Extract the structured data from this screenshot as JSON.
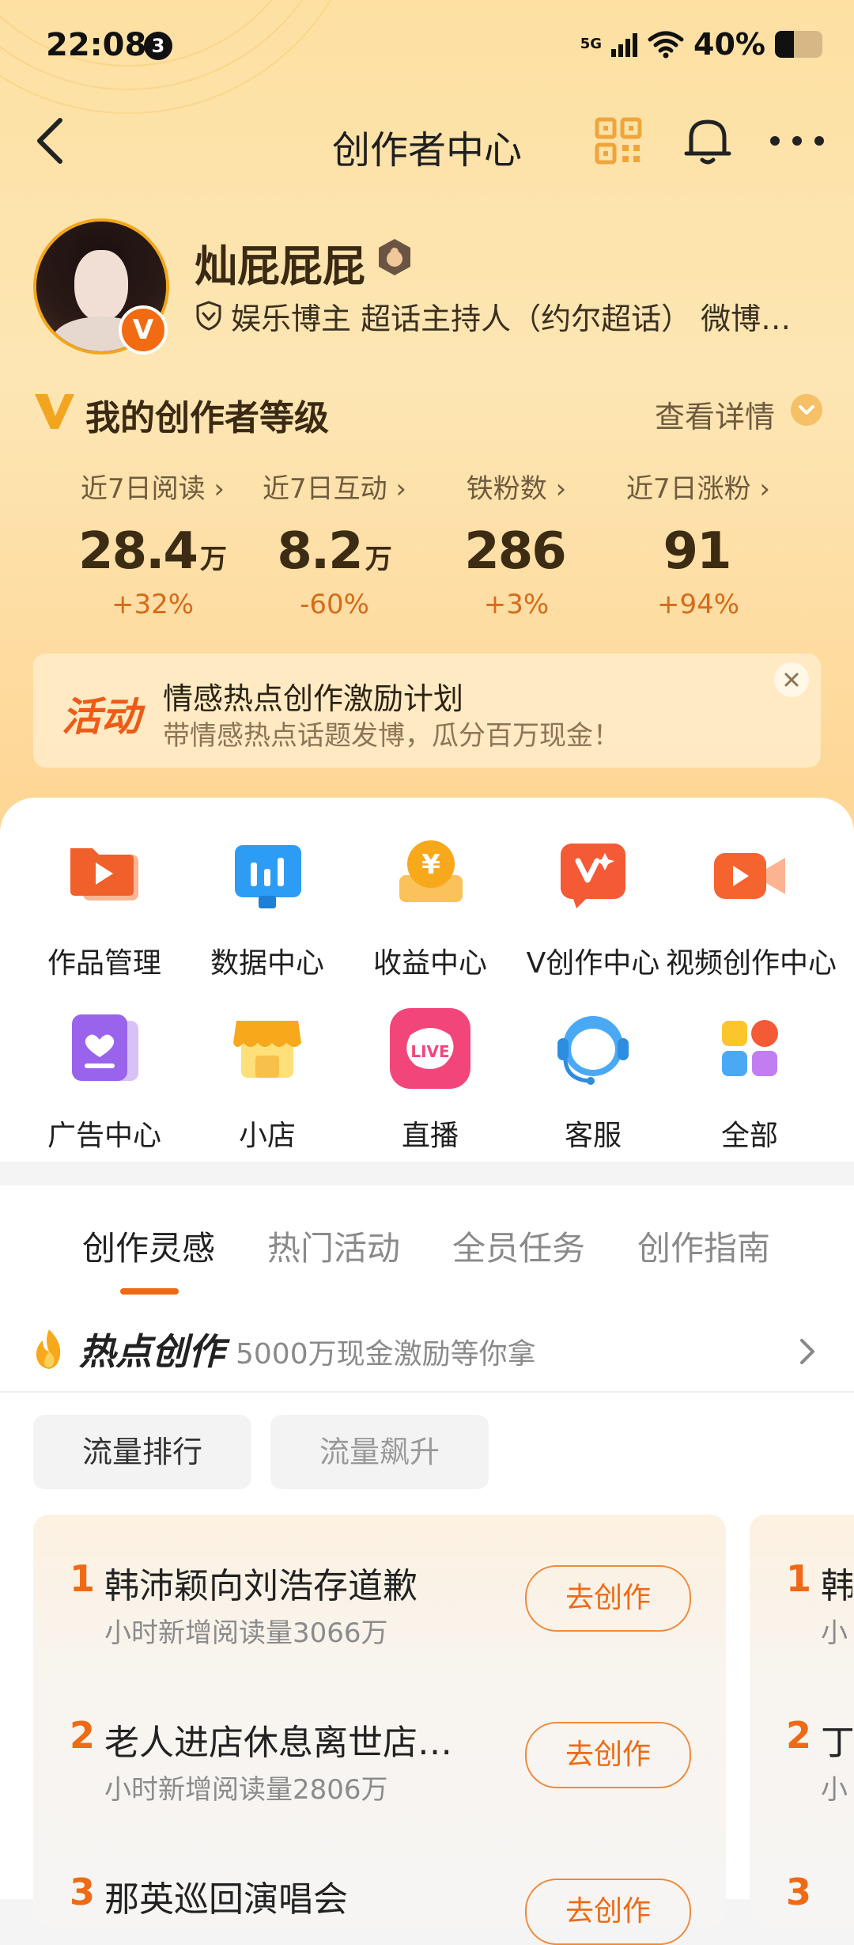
{
  "status_bar": {
    "time": "22:08",
    "notification_count": "3",
    "network": "5G",
    "battery": "40%",
    "battery_level": 0.4
  },
  "nav": {
    "title": "创作者中心",
    "icons": [
      "back-icon",
      "qr-code-icon",
      "bell-icon",
      "more-icon"
    ]
  },
  "profile": {
    "username": "灿屁屁屁",
    "tags": "娱乐博主 超话主持人（约尔超话） 微博…",
    "verified_badge": "V"
  },
  "level": {
    "title": "我的创作者等级",
    "detail_link": "查看详情"
  },
  "stats": [
    {
      "label": "近7日阅读 ›",
      "value": "28.4",
      "unit": "万",
      "change": "+32%"
    },
    {
      "label": "近7日互动 ›",
      "value": "8.2",
      "unit": "万",
      "change": "-60%"
    },
    {
      "label": "铁粉数 ›",
      "value": "286",
      "unit": "",
      "change": "+3%"
    },
    {
      "label": "近7日涨粉 ›",
      "value": "91",
      "unit": "",
      "change": "+94%"
    }
  ],
  "activity": {
    "tag": "活动",
    "title": "情感热点创作激励计划",
    "subtitle": "带情感热点话题发博，瓜分百万现金！"
  },
  "tools": [
    {
      "label": "作品管理",
      "icon": "works-folder-icon"
    },
    {
      "label": "数据中心",
      "icon": "data-chart-icon"
    },
    {
      "label": "收益中心",
      "icon": "income-yuan-icon"
    },
    {
      "label": "V创作中心",
      "icon": "v-create-icon"
    },
    {
      "label": "视频创作中心",
      "icon": "video-camera-icon"
    },
    {
      "label": "广告中心",
      "icon": "ad-heart-icon"
    },
    {
      "label": "小店",
      "icon": "shop-icon"
    },
    {
      "label": "直播",
      "icon": "live-icon"
    },
    {
      "label": "客服",
      "icon": "customer-service-icon"
    },
    {
      "label": "全部",
      "icon": "all-apps-icon"
    }
  ],
  "tabs": [
    "创作灵感",
    "热门活动",
    "全员任务",
    "创作指南"
  ],
  "active_tab": 0,
  "hot": {
    "title": "热点创作",
    "subtitle": "5000万现金激励等你拿"
  },
  "pills": [
    "流量排行",
    "流量飙升"
  ],
  "ranking": [
    {
      "no": "1",
      "title": "韩沛颖向刘浩存道歉",
      "sub": "小时新增阅读量3066万",
      "button": "去创作"
    },
    {
      "no": "2",
      "title": "老人进店休息离世店…",
      "sub": "小时新增阅读量2806万",
      "button": "去创作"
    },
    {
      "no": "3",
      "title": "那英巡回演唱会",
      "sub": "",
      "button": "去创作"
    }
  ],
  "ranking_peek": [
    {
      "no": "1",
      "title": "韩",
      "sub": "小"
    },
    {
      "no": "2",
      "title": "丁",
      "sub": "小"
    },
    {
      "no": "3",
      "title": "",
      "sub": ""
    }
  ],
  "colors": {
    "accent": "#ee6a14",
    "hero_bg": "#fde0a2",
    "text_dark": "#3a2a14"
  }
}
